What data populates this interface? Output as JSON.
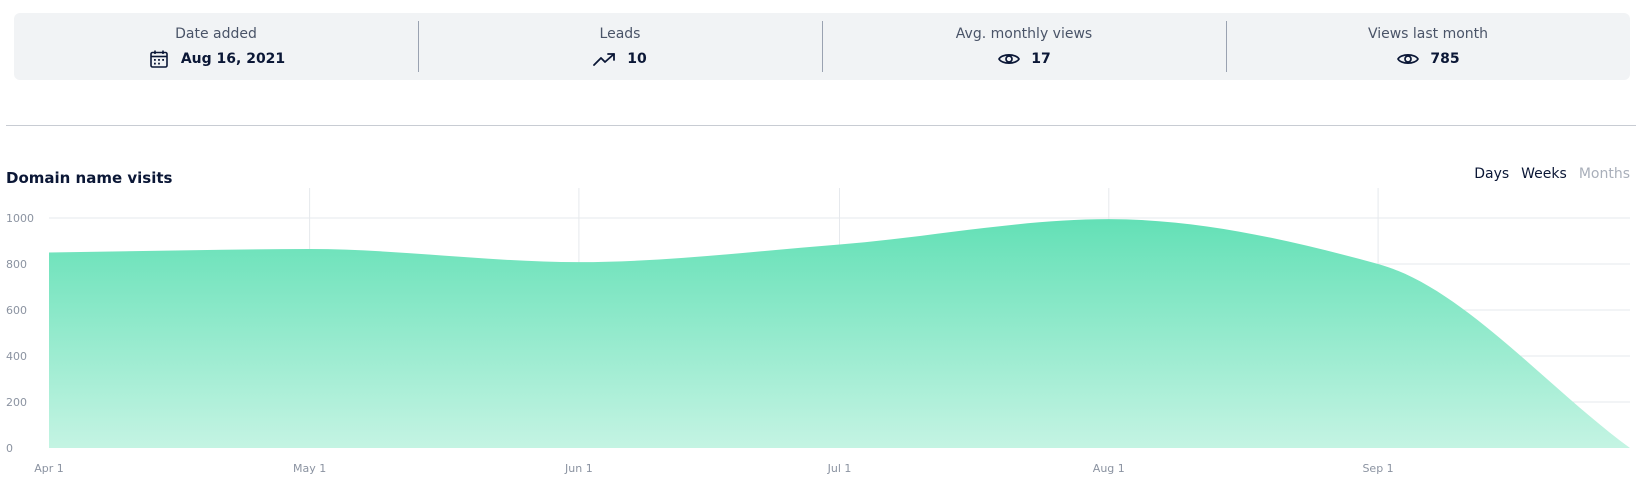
{
  "stats": [
    {
      "label": "Date added",
      "value": "Aug 16, 2021",
      "icon": "calendar-icon"
    },
    {
      "label": "Leads",
      "value": "10",
      "icon": "trending-up-icon"
    },
    {
      "label": "Avg. monthly views",
      "value": "17",
      "icon": "eye-icon"
    },
    {
      "label": "Views last month",
      "value": "785",
      "icon": "eye-icon"
    }
  ],
  "chart_header": {
    "title": "Domain name visits",
    "toggle": [
      {
        "label": "Days",
        "active": true
      },
      {
        "label": "Weeks",
        "active": true
      },
      {
        "label": "Months",
        "active": false
      }
    ]
  },
  "colors": {
    "area_top": "#63e0b6",
    "area_bottom": "#c4f4e3",
    "grid": "#e6e9ed",
    "tick_text": "#8b93a1"
  },
  "chart_data": {
    "type": "area",
    "title": "Domain name visits",
    "xlabel": "",
    "ylabel": "",
    "x_ticks": [
      "Apr 1",
      "May 1",
      "Jun 1",
      "Jul 1",
      "Aug 1",
      "Sep 1"
    ],
    "x": [
      "2021-04-01",
      "2021-05-01",
      "2021-06-01",
      "2021-07-01",
      "2021-08-01",
      "2021-09-01",
      "2021-09-30"
    ],
    "series": [
      {
        "values": [
          850,
          865,
          808,
          885,
          995,
          800,
          0
        ]
      }
    ],
    "ylim": [
      0,
      1000
    ],
    "y_ticks": [
      0,
      200,
      400,
      600,
      800,
      1000
    ],
    "grid": true,
    "legend": "none"
  }
}
